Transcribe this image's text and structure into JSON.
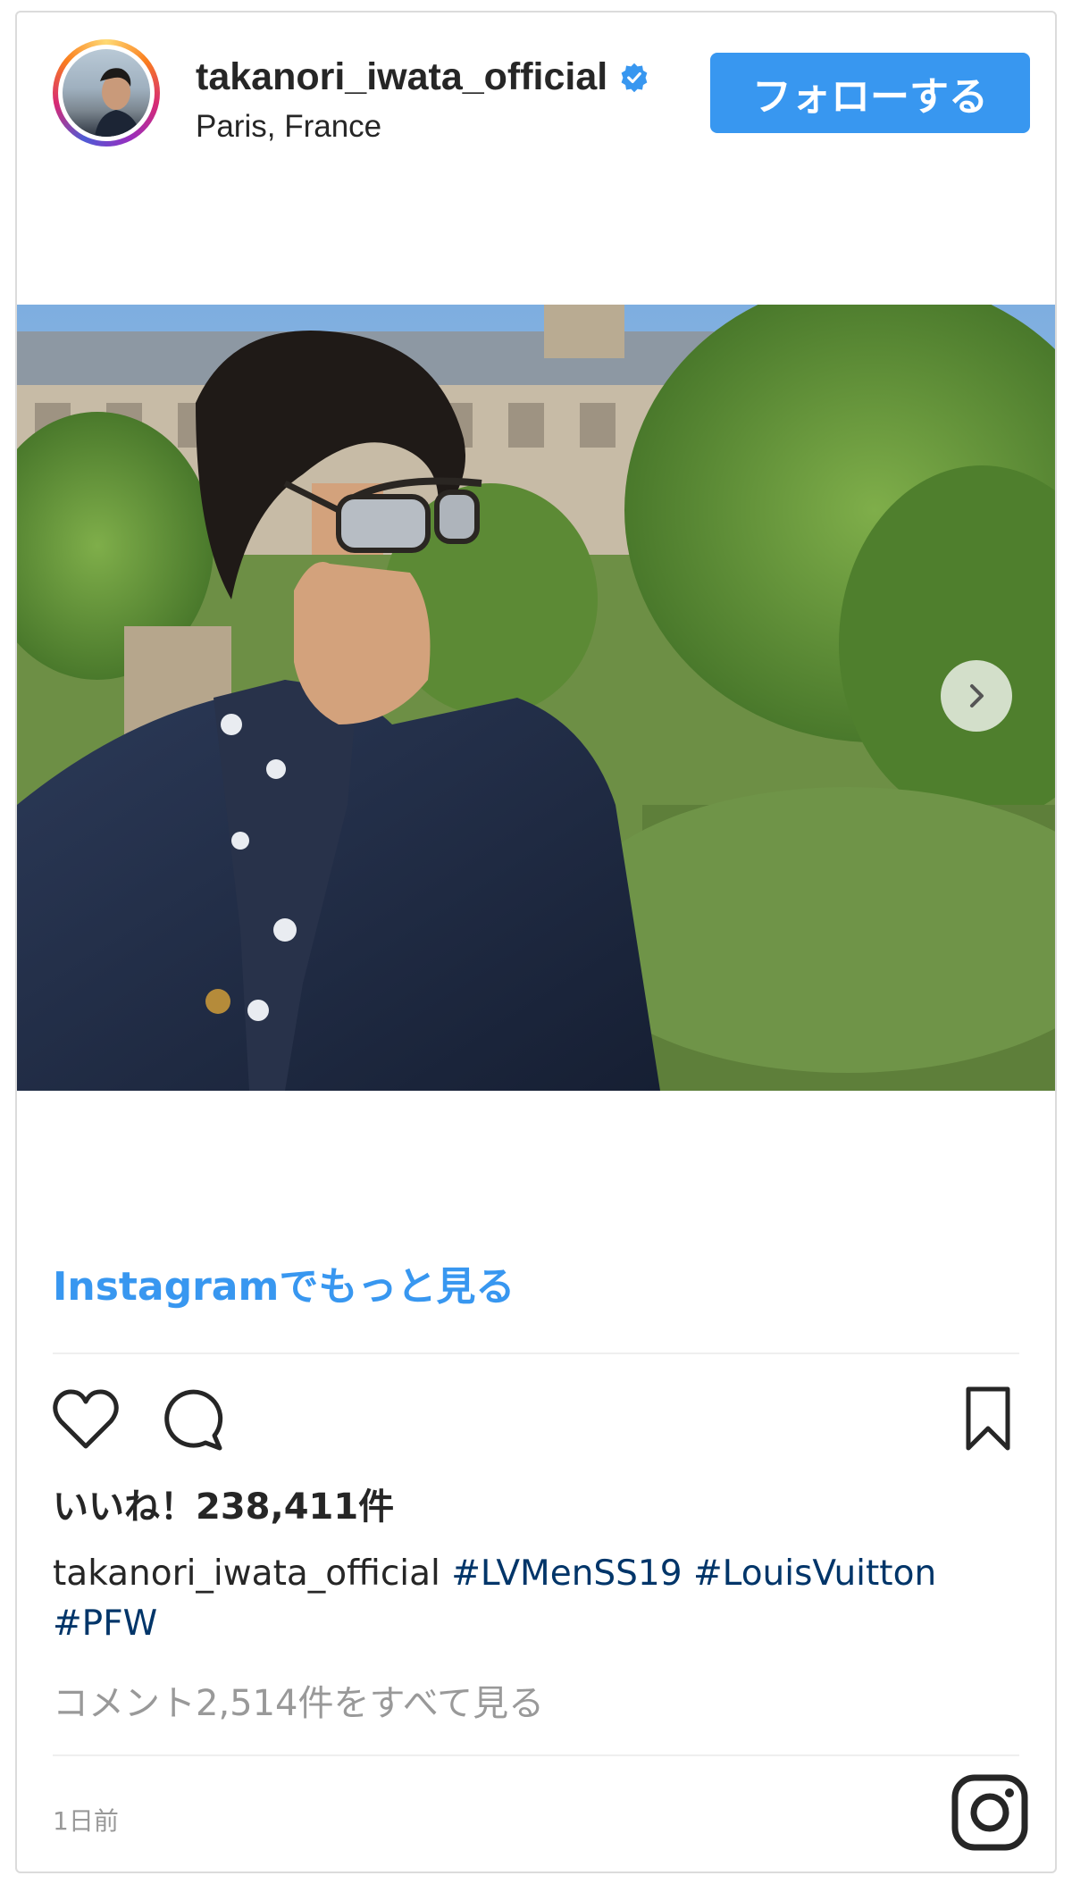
{
  "post": {
    "username": "takanori_iwata_official",
    "location": "Paris, France",
    "follow_label": "フォローする",
    "more_link": "Instagramでもっと見る",
    "likes": "いいね！238,411件",
    "caption_user": "takanori_iwata_official",
    "hashtags": [
      "#LVMenSS19",
      "#LouisVuitton",
      "#PFW"
    ],
    "comments_link": "コメント2,514件をすべて見る",
    "timestamp": "1日前"
  },
  "icons": {
    "verified": "verified-badge-icon",
    "heart": "heart-icon",
    "comment": "comment-icon",
    "bookmark": "bookmark-icon",
    "next": "chevron-right-icon",
    "instagram": "instagram-logo-icon"
  },
  "colors": {
    "accent": "#3897f0",
    "hashtag": "#003569",
    "muted": "#999999",
    "text": "#262626",
    "border": "#dbdbdb"
  }
}
